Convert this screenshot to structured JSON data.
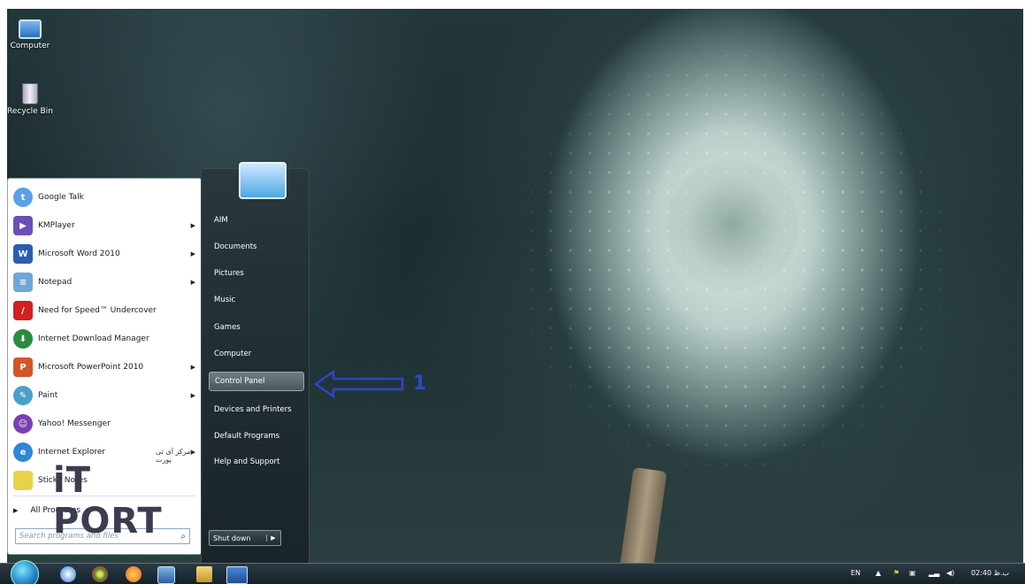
{
  "desktop": {
    "icons": [
      {
        "label": "Computer",
        "icon": "computer-icon"
      },
      {
        "label": "Recycle Bin",
        "icon": "recycle-bin-icon"
      }
    ]
  },
  "start_menu": {
    "programs": [
      {
        "label": "Google Talk",
        "icon": "google-talk-icon",
        "submenu": false,
        "color": "#5aa0e6"
      },
      {
        "label": "KMPlayer",
        "icon": "kmplayer-icon",
        "submenu": true,
        "color": "#6a4fb5"
      },
      {
        "label": "Microsoft Word 2010",
        "icon": "word-icon",
        "submenu": true,
        "color": "#2a5db0"
      },
      {
        "label": "Notepad",
        "icon": "notepad-icon",
        "submenu": true,
        "color": "#6fa7d8"
      },
      {
        "label": "Need for Speed™ Undercover",
        "icon": "nfs-icon",
        "submenu": false,
        "color": "#d32020"
      },
      {
        "label": "Internet Download Manager",
        "icon": "idm-icon",
        "submenu": false,
        "color": "#2b8a3e"
      },
      {
        "label": "Microsoft PowerPoint 2010",
        "icon": "powerpoint-icon",
        "submenu": true,
        "color": "#d2562a"
      },
      {
        "label": "Paint",
        "icon": "paint-icon",
        "submenu": true,
        "color": "#4aa0c8"
      },
      {
        "label": "Yahoo! Messenger",
        "icon": "yahoo-icon",
        "submenu": false,
        "color": "#7b3fb3"
      },
      {
        "label": "Internet Explorer",
        "icon": "ie-icon",
        "submenu": true,
        "color": "#2e86d6"
      },
      {
        "label": "Sticky Notes",
        "icon": "sticky-notes-icon",
        "submenu": false,
        "color": "#e8d24a"
      }
    ],
    "all_programs": "All Programs",
    "search_placeholder": "Search programs and files",
    "right_links": [
      {
        "label": "AIM"
      },
      {
        "label": "Documents"
      },
      {
        "label": "Pictures"
      },
      {
        "label": "Music"
      },
      {
        "label": "Games"
      },
      {
        "label": "Computer"
      },
      {
        "label": "Control Panel",
        "highlighted": true
      },
      {
        "label": "Devices and Printers"
      },
      {
        "label": "Default Programs"
      },
      {
        "label": "Help and Support"
      }
    ],
    "shutdown_label": "Shut down"
  },
  "watermark": {
    "text": "iT PORT",
    "small_text": "مرکز آی تی پورت"
  },
  "annotation": {
    "label": "1",
    "color": "#2d47c8"
  },
  "taskbar": {
    "language": "EN",
    "clock": "02:40 ب.ظ"
  }
}
